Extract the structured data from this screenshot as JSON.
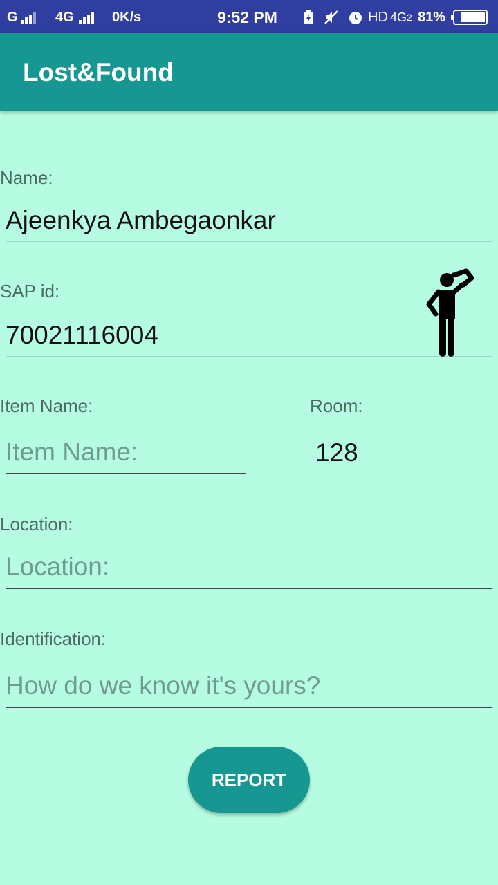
{
  "status_bar": {
    "carrier1": "G",
    "carrier2": "4G",
    "speed": "0K/s",
    "time": "9:52 PM",
    "hd": "HD",
    "net": "4G",
    "net_sub": "2",
    "battery": "81%"
  },
  "app_bar": {
    "title": "Lost&Found"
  },
  "form": {
    "name_label": "Name:",
    "name_value": "Ajeenkya Ambegaonkar",
    "sap_label": "SAP id:",
    "sap_value": "70021116004",
    "item_label": "Item Name:",
    "item_placeholder": "Item Name:",
    "room_label": "Room:",
    "room_value": "128",
    "location_label": "Location:",
    "location_placeholder": "Location:",
    "identification_label": "Identification:",
    "identification_placeholder": "How do we know it's yours?",
    "report_label": "REPORT"
  },
  "icons": {
    "figure": "thinking-person-icon"
  },
  "colors": {
    "status_bar": "#2f3e9f",
    "app_bar": "#179792",
    "background": "#b6fce2",
    "button": "#179792"
  }
}
